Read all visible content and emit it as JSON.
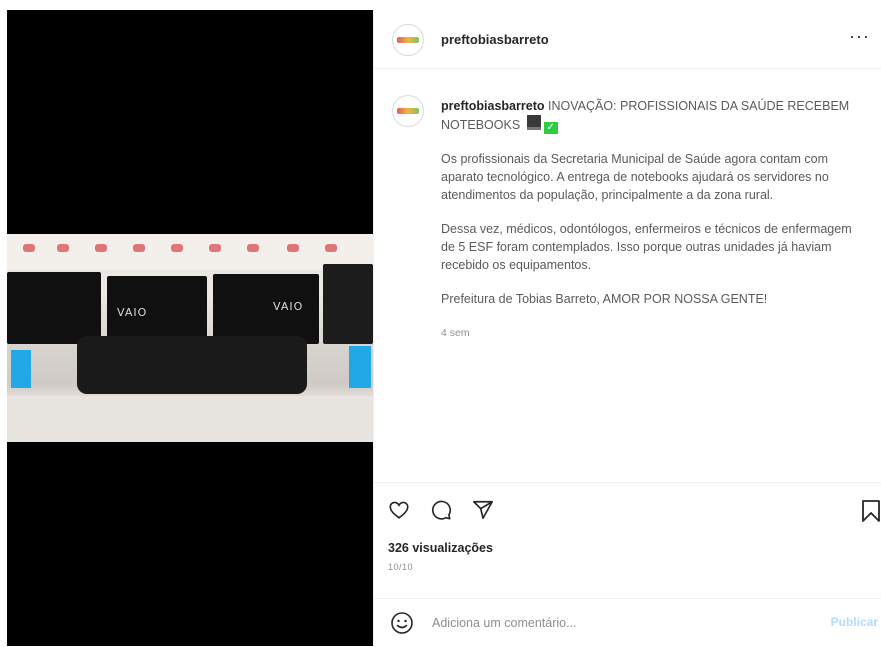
{
  "post": {
    "username": "preftobiasbarreto",
    "more_icon": "more-icon",
    "caption_headline": "INOVAÇÃO: PROFISSIONAIS DA SAÚDE RECEBEM NOTEBOOKS",
    "paragraph_1": "Os profissionais da Secretaria Municipal de Saúde agora contam com aparato tecnológico. A entrega de notebooks ajudará os servidores no atendimentos da população, principalmente a da zona rural.",
    "paragraph_2": "Dessa vez, médicos, odontólogos, enfermeiros e técnicos de enfermagem de 5 ESF foram contemplados. Isso porque outras unidades já haviam recebido os equipamentos.",
    "paragraph_3": "Prefeitura de Tobias Barreto, AMOR POR NOSSA GENTE!",
    "time_ago": "4 sem"
  },
  "media": {
    "brand_label_left": "VAIO",
    "brand_label_right": "VAIO"
  },
  "actions": {
    "icons": [
      "heart-icon",
      "comment-icon",
      "share-icon",
      "bookmark-icon"
    ],
    "views": "326 visualizações",
    "date": "10/10"
  },
  "comment": {
    "placeholder": "Adiciona um comentário...",
    "publish_label": "Publicar",
    "emoji_icon": "emoji-icon"
  },
  "colors": {
    "accent_disabled": "#b3dbff",
    "text_primary": "#262626",
    "text_secondary": "#8e8e8e"
  }
}
